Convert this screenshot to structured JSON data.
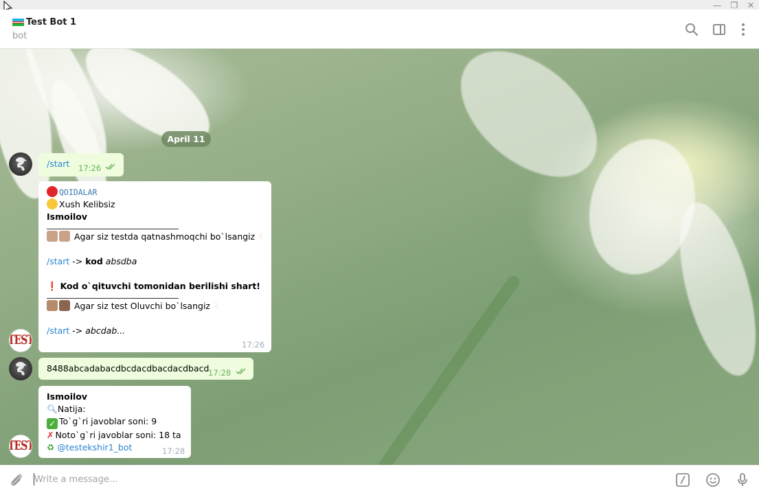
{
  "window": {
    "minimize_glyph": "—",
    "restore_glyph": "❐",
    "close_glyph": "✕"
  },
  "header": {
    "title": "Test Bot 1",
    "subtitle": "bot"
  },
  "chat": {
    "date_separator": "April 11",
    "messages": [
      {
        "id": "m1",
        "direction": "outgoing",
        "text": "/start",
        "time": "17:26",
        "status": "read"
      },
      {
        "id": "m2",
        "direction": "incoming",
        "time": "17:26",
        "lines": {
          "qoidalar": "QOIDALAR",
          "greeting": "Xush Kelibsiz",
          "name": "Ismoilov",
          "teacher_hint": "Agar siz testda qatnashmoqchi bo`lsangiz",
          "cmd1": "/start",
          "arrow1": " -> ",
          "kod_label": "kod",
          "kod_example": "absdba",
          "warning": "Kod o`qituvchi tomonidan berilishi shart!",
          "student_hint": "Agar siz test Oluvchi bo`lsangiz",
          "cmd2": "/start",
          "arrow2": " -> ",
          "answer_example": "abcdab..."
        }
      },
      {
        "id": "m3",
        "direction": "outgoing",
        "text": "8488abcadabacdbcdacdbacdacdbacd",
        "time": "17:28",
        "status": "read"
      },
      {
        "id": "m4",
        "direction": "incoming",
        "time": "17:28",
        "lines": {
          "name": "Ismoilov",
          "natija": "Natija:",
          "correct_label": "To`g`ri javoblar soni: ",
          "correct_count": "9",
          "wrong_label": "Noto`g`ri javoblar soni: ",
          "wrong_count": "18",
          "wrong_suffix": " ta",
          "bot_link": "@testekshir1_bot"
        }
      }
    ]
  },
  "composer": {
    "placeholder": "Write a message..."
  },
  "icons": {
    "search": "search-icon",
    "sidebar": "sidebar-toggle-icon",
    "more": "more-vertical-icon",
    "attach": "paperclip-icon",
    "commands": "bot-commands-icon",
    "emoji": "emoji-icon",
    "mic": "microphone-icon"
  },
  "colors": {
    "outgoing_bubble": "#effdde",
    "incoming_bubble": "#ffffff",
    "link": "#2a86d2",
    "date_pill": "#6e875f"
  }
}
